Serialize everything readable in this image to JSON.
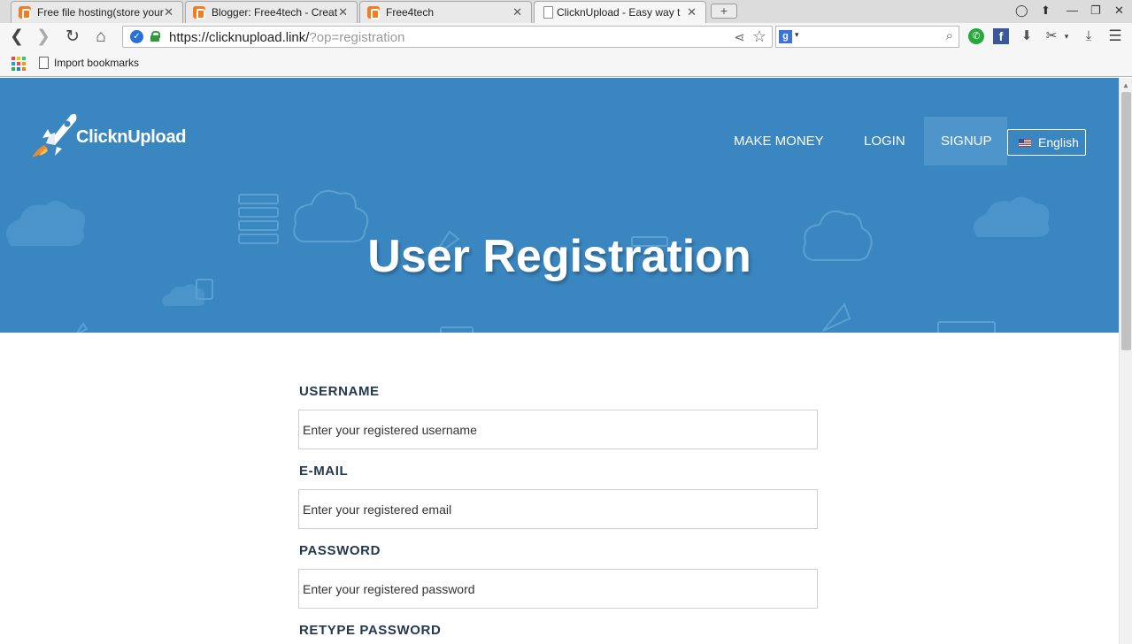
{
  "browser": {
    "tabs": [
      {
        "title": "Free file hosting(store your",
        "favicon": "blogger-icon",
        "active": false
      },
      {
        "title": "Blogger: Free4tech - Creat",
        "favicon": "blogger-icon",
        "active": false
      },
      {
        "title": "Free4tech",
        "favicon": "blogger-icon",
        "active": false
      },
      {
        "title": "ClicknUpload - Easy way t",
        "favicon": "document-icon",
        "active": true
      }
    ],
    "new_tab": "+",
    "url_main": "https://clicknupload.link/",
    "url_query": "?op=registration",
    "search_engine": "g",
    "bookmarks": [
      {
        "label": "Import bookmarks"
      }
    ]
  },
  "site": {
    "brand": "ClicknUpload",
    "nav": [
      {
        "label": "MAKE MONEY",
        "active": false
      },
      {
        "label": "LOGIN",
        "active": false
      },
      {
        "label": "SIGNUP",
        "active": true
      }
    ],
    "language": "English",
    "hero_title": "User Registration",
    "accent_color": "#3a86c0"
  },
  "form": {
    "fields": [
      {
        "label": "USERNAME",
        "placeholder": "Enter your registered username"
      },
      {
        "label": "E-MAIL",
        "placeholder": "Enter your registered email"
      },
      {
        "label": "PASSWORD",
        "placeholder": "Enter your registered password"
      },
      {
        "label": "RETYPE PASSWORD"
      }
    ]
  }
}
